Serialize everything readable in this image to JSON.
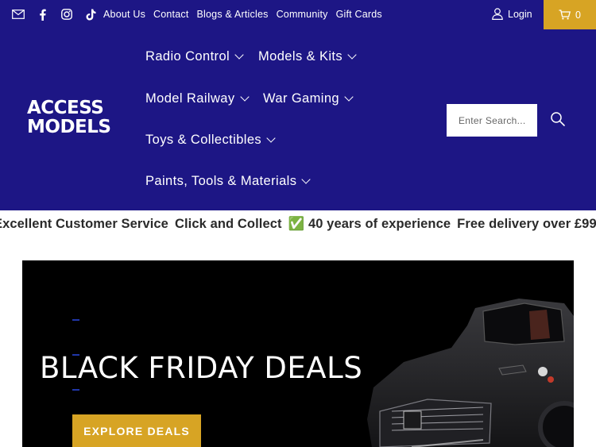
{
  "topbar": {
    "social_icons": [
      "email-icon",
      "facebook-icon",
      "instagram-icon",
      "tiktok-icon"
    ],
    "links": [
      "About Us",
      "Contact",
      "Blogs & Articles",
      "Community",
      "Gift Cards"
    ],
    "login_label": "Login",
    "cart_count": "0"
  },
  "logo": {
    "line1": "ACCESS",
    "line2": "MODELS"
  },
  "nav": {
    "items": [
      "Radio Control",
      "Models & Kits",
      "Model Railway",
      "War Gaming",
      "Toys & Collectibles",
      "Paints, Tools & Materials"
    ]
  },
  "search": {
    "placeholder": "Enter Search..."
  },
  "ticker": {
    "items": [
      "Excellent Customer Service",
      "Click and Collect",
      "✅ 40 years of experience",
      "Free delivery over £99"
    ]
  },
  "banner": {
    "title": "BLACK FRIDAY DEALS",
    "cta_label": "EXPLORE DEALS"
  },
  "colors": {
    "header_bg": "#1d1685",
    "accent": "#d7a424",
    "banner_bg": "#000000"
  }
}
